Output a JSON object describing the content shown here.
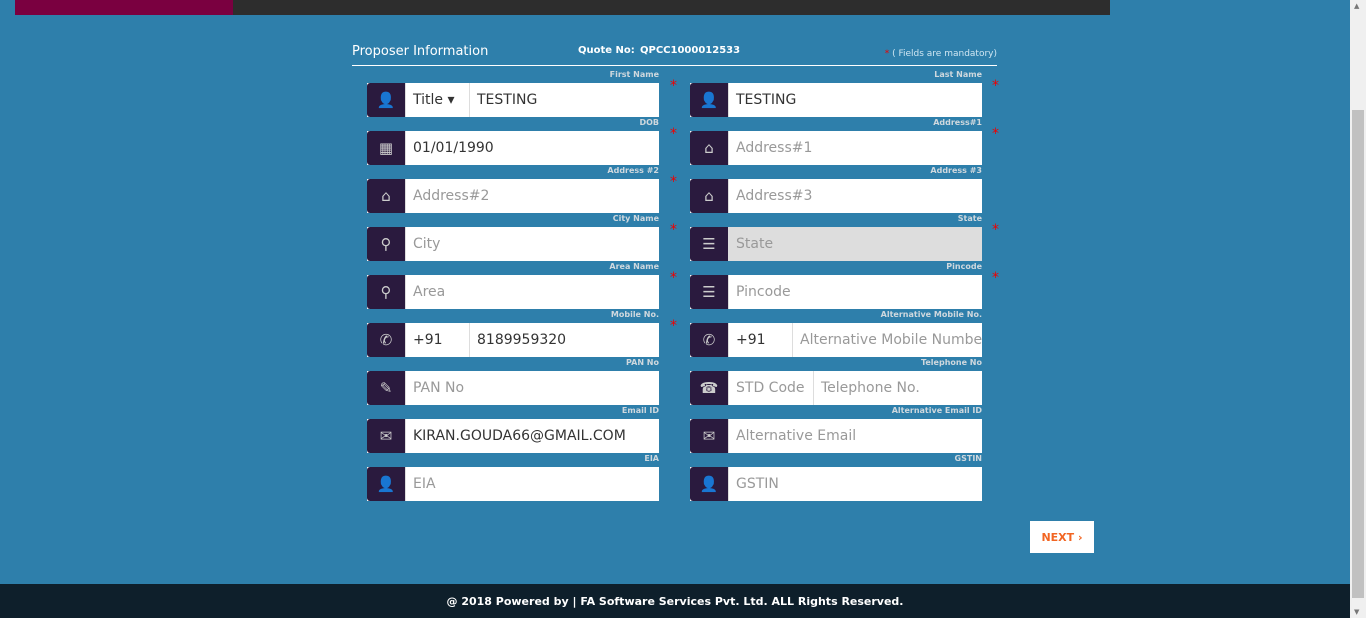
{
  "header": {
    "title": "Proposer Information",
    "quote_label": "Quote No:",
    "quote_no": "QPCC1000012533",
    "mandatory_star": "*",
    "mandatory_note": "( Fields are mandatory)"
  },
  "fields": [
    {
      "label": "First Name",
      "required": true,
      "icon": "user-icon",
      "parts": [
        {
          "value": "Title ▾",
          "select": true,
          "w": 64
        },
        {
          "value": "TESTING"
        }
      ]
    },
    {
      "label": "Last Name",
      "required": true,
      "icon": "user-icon",
      "parts": [
        {
          "value": "TESTING"
        }
      ]
    },
    {
      "label": "DOB",
      "required": true,
      "icon": "calendar-icon",
      "parts": [
        {
          "value": "01/01/1990"
        }
      ]
    },
    {
      "label": "Address#1",
      "required": true,
      "icon": "home-icon",
      "parts": [
        {
          "placeholder": "Address#1"
        }
      ]
    },
    {
      "label": "Address #2",
      "required": true,
      "icon": "home-icon",
      "parts": [
        {
          "placeholder": "Address#2"
        }
      ]
    },
    {
      "label": "Address #3",
      "required": false,
      "icon": "home-icon",
      "parts": [
        {
          "placeholder": "Address#3"
        }
      ]
    },
    {
      "label": "City Name",
      "required": true,
      "icon": "map-marker-icon",
      "parts": [
        {
          "placeholder": "City"
        }
      ]
    },
    {
      "label": "State",
      "required": true,
      "icon": "list-icon",
      "parts": [
        {
          "placeholder": "State",
          "disabled": true
        }
      ]
    },
    {
      "label": "Area Name",
      "required": true,
      "icon": "map-marker-icon",
      "parts": [
        {
          "placeholder": "Area"
        }
      ]
    },
    {
      "label": "Pincode",
      "required": true,
      "icon": "list-icon",
      "parts": [
        {
          "placeholder": "Pincode"
        }
      ]
    },
    {
      "label": "Mobile No.",
      "required": true,
      "icon": "phone-icon",
      "parts": [
        {
          "value": "+91",
          "w": 64
        },
        {
          "value": "8189959320"
        }
      ]
    },
    {
      "label": "Alternative Mobile No.",
      "required": false,
      "icon": "phone-icon",
      "parts": [
        {
          "value": "+91",
          "w": 64
        },
        {
          "placeholder": "Alternative Mobile Number"
        }
      ]
    },
    {
      "label": "PAN No",
      "required": false,
      "icon": "pencil-icon",
      "parts": [
        {
          "placeholder": "PAN No"
        }
      ]
    },
    {
      "label": "Telephone No",
      "required": false,
      "icon": "telephone-icon",
      "parts": [
        {
          "placeholder": "STD Code",
          "w": 85
        },
        {
          "placeholder": "Telephone No."
        }
      ]
    },
    {
      "label": "Email ID",
      "required": false,
      "icon": "envelope-icon",
      "parts": [
        {
          "value": "KIRAN.GOUDA66@GMAIL.COM"
        }
      ]
    },
    {
      "label": "Alternative Email ID",
      "required": false,
      "icon": "envelope-icon",
      "parts": [
        {
          "placeholder": "Alternative Email"
        }
      ]
    },
    {
      "label": "EIA",
      "required": false,
      "icon": "user-icon",
      "parts": [
        {
          "placeholder": "EIA"
        }
      ]
    },
    {
      "label": "GSTIN",
      "required": false,
      "icon": "user-icon",
      "parts": [
        {
          "placeholder": "GSTIN"
        }
      ]
    }
  ],
  "next_label": "NEXT ›",
  "footer": "@ 2018  Powered by | FA Software Services Pvt. Ltd.  ALL Rights Reserved.",
  "colors": {
    "background": "#2e7fab",
    "icon_bg": "#2a1a3e",
    "next_text": "#f26522",
    "footer_bg": "#0e1f2b",
    "required": "#e00000"
  }
}
